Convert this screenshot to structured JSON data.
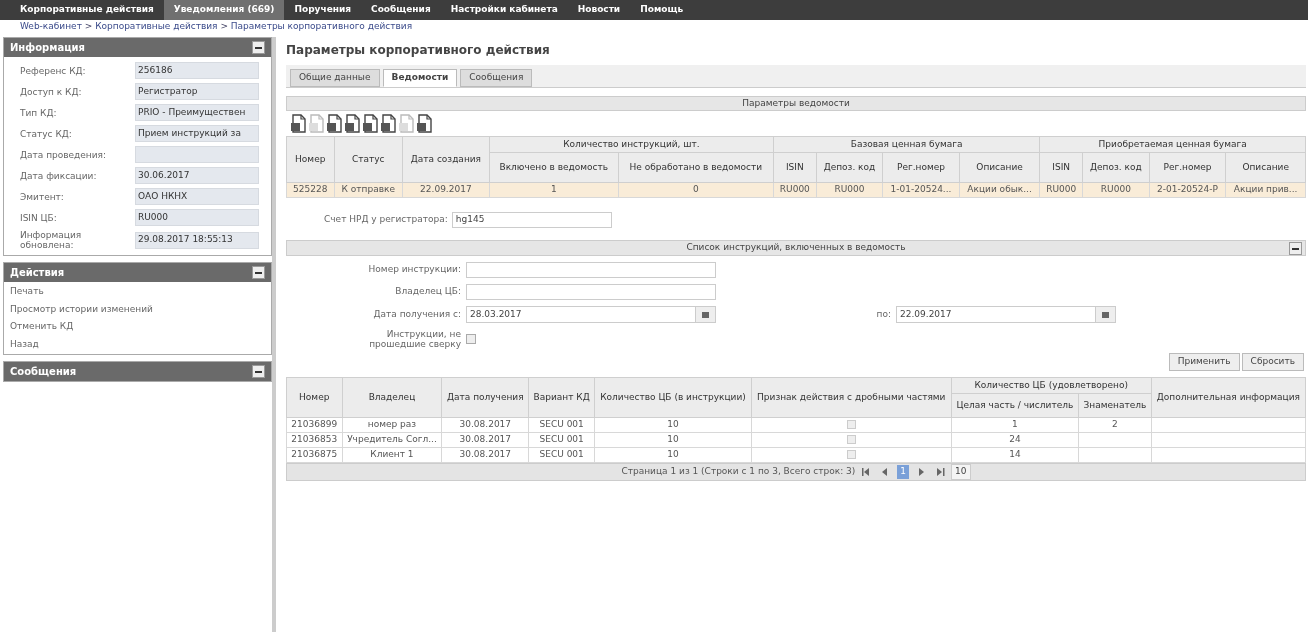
{
  "nav": [
    {
      "label": "Корпоративные действия",
      "selected": false
    },
    {
      "label": "Уведомления (669)",
      "selected": true
    },
    {
      "label": "Поручения",
      "selected": false
    },
    {
      "label": "Сообщения",
      "selected": false
    },
    {
      "label": "Настройки кабинета",
      "selected": false
    },
    {
      "label": "Новости",
      "selected": false
    },
    {
      "label": "Помощь",
      "selected": false
    }
  ],
  "breadcrumb": [
    "Web-кабинет",
    "Корпоративные действия",
    "Параметры корпоративного действия"
  ],
  "breadcrumb_separator": ">",
  "info_panel": {
    "title": "Информация",
    "fields": [
      {
        "label": "Референс КД:",
        "value": "256186"
      },
      {
        "label": "Доступ к КД:",
        "value": "Регистратор"
      },
      {
        "label": "Тип КД:",
        "value": "PRIO - Преимуществен"
      },
      {
        "label": "Статус КД:",
        "value": "Прием инструкций за"
      },
      {
        "label": "Дата проведения:"
      },
      {
        "label": "Дата фиксации:",
        "value": "30.06.2017"
      },
      {
        "label": "Эмитент:",
        "value": "ОАО НКНХ"
      },
      {
        "label": "ISIN ЦБ:",
        "value": "RU000"
      },
      {
        "label": "Информация обновлена:",
        "value": "29.08.2017 18:55:13"
      }
    ]
  },
  "actions_panel": {
    "title": "Действия",
    "items": [
      "Печать",
      "Просмотр истории изменений",
      "Отменить КД",
      "Назад"
    ]
  },
  "messages_panel": {
    "title": "Сообщения"
  },
  "page_title": "Параметры корпоративного действия",
  "tabs": [
    {
      "label": "Общие данные",
      "selected": false
    },
    {
      "label": "Ведомости",
      "selected": true
    },
    {
      "label": "Сообщения",
      "selected": false
    }
  ],
  "statement_section": {
    "title": "Параметры ведомости",
    "toolbar": [
      {
        "disabled": false
      },
      {
        "disabled": true
      },
      {
        "disabled": false
      },
      {
        "disabled": false
      },
      {
        "disabled": false
      },
      {
        "disabled": false
      },
      {
        "disabled": true
      },
      {
        "disabled": false
      }
    ],
    "columns": [
      "Номер",
      "Статус",
      "Дата создания"
    ],
    "group_instructions": {
      "title": "Количество инструкций, шт.",
      "columns": [
        "Включено в ведомость",
        "Не обработано в ведомости"
      ]
    },
    "group_base": {
      "title": "Базовая ценная бумага",
      "columns": [
        "ISIN",
        "Депоз. код",
        "Рег.номер",
        "Описание"
      ]
    },
    "group_acquired": {
      "title": "Приобретаемая ценная бумага",
      "columns": [
        "ISIN",
        "Депоз. код",
        "Рег.номер",
        "Описание"
      ]
    },
    "rows": [
      {
        "selected": true,
        "cells": [
          "525228",
          "К отправке",
          "22.09.2017",
          "1",
          "0",
          "RU000",
          "RU000",
          "1-01-20524...",
          "Акции обык...",
          "RU000",
          "RU000",
          "2-01-20524-P",
          "Акции прив..."
        ]
      }
    ],
    "account": {
      "label": "Счет НРД у регистратора:",
      "value": "hg145"
    }
  },
  "instructions_section": {
    "title": "Список инструкций, включенных в ведомость",
    "number": {
      "label": "Номер инструкции:"
    },
    "owner": {
      "label": "Владелец ЦБ:"
    },
    "date_from": {
      "label": "Дата получения с:",
      "value": "28.03.2017"
    },
    "date_to": {
      "label": "по:",
      "value": "22.09.2017"
    },
    "unmatched": {
      "label": "Инструкции, не прошедшие сверку",
      "checked": false
    },
    "buttons": [
      "Применить",
      "Сбросить"
    ],
    "columns": [
      "Номер",
      "Владелец",
      "Дата получения",
      "Вариант КД",
      "Количество ЦБ (в инструкции)",
      "Признак действия с дробными частями"
    ],
    "group_satisfied": {
      "title": "Количество ЦБ (удовлетворено)",
      "columns": [
        "Целая часть / числитель",
        "Знаменатель"
      ]
    },
    "last_column": "Дополнительная информация",
    "rows": [
      {
        "number": "21036899",
        "owner": "номер раз",
        "date": "30.08.2017",
        "variant": "SECU 001",
        "qty": "10",
        "fractional": false,
        "whole": "1",
        "denominator": "2"
      },
      {
        "number": "21036853",
        "owner": "Учредитель Согл...",
        "date": "30.08.2017",
        "variant": "SECU 001",
        "qty": "10",
        "fractional": false,
        "whole": "24"
      },
      {
        "number": "21036875",
        "owner": "Клиент 1",
        "date": "30.08.2017",
        "variant": "SECU 001",
        "qty": "10",
        "fractional": false,
        "whole": "14"
      }
    ],
    "pager": {
      "summary": "Страница 1 из 1 (Строки с 1 по 3, Всего строк: 3)",
      "pages": [
        {
          "label": "1",
          "selected": true
        }
      ],
      "page_size": "10"
    }
  }
}
